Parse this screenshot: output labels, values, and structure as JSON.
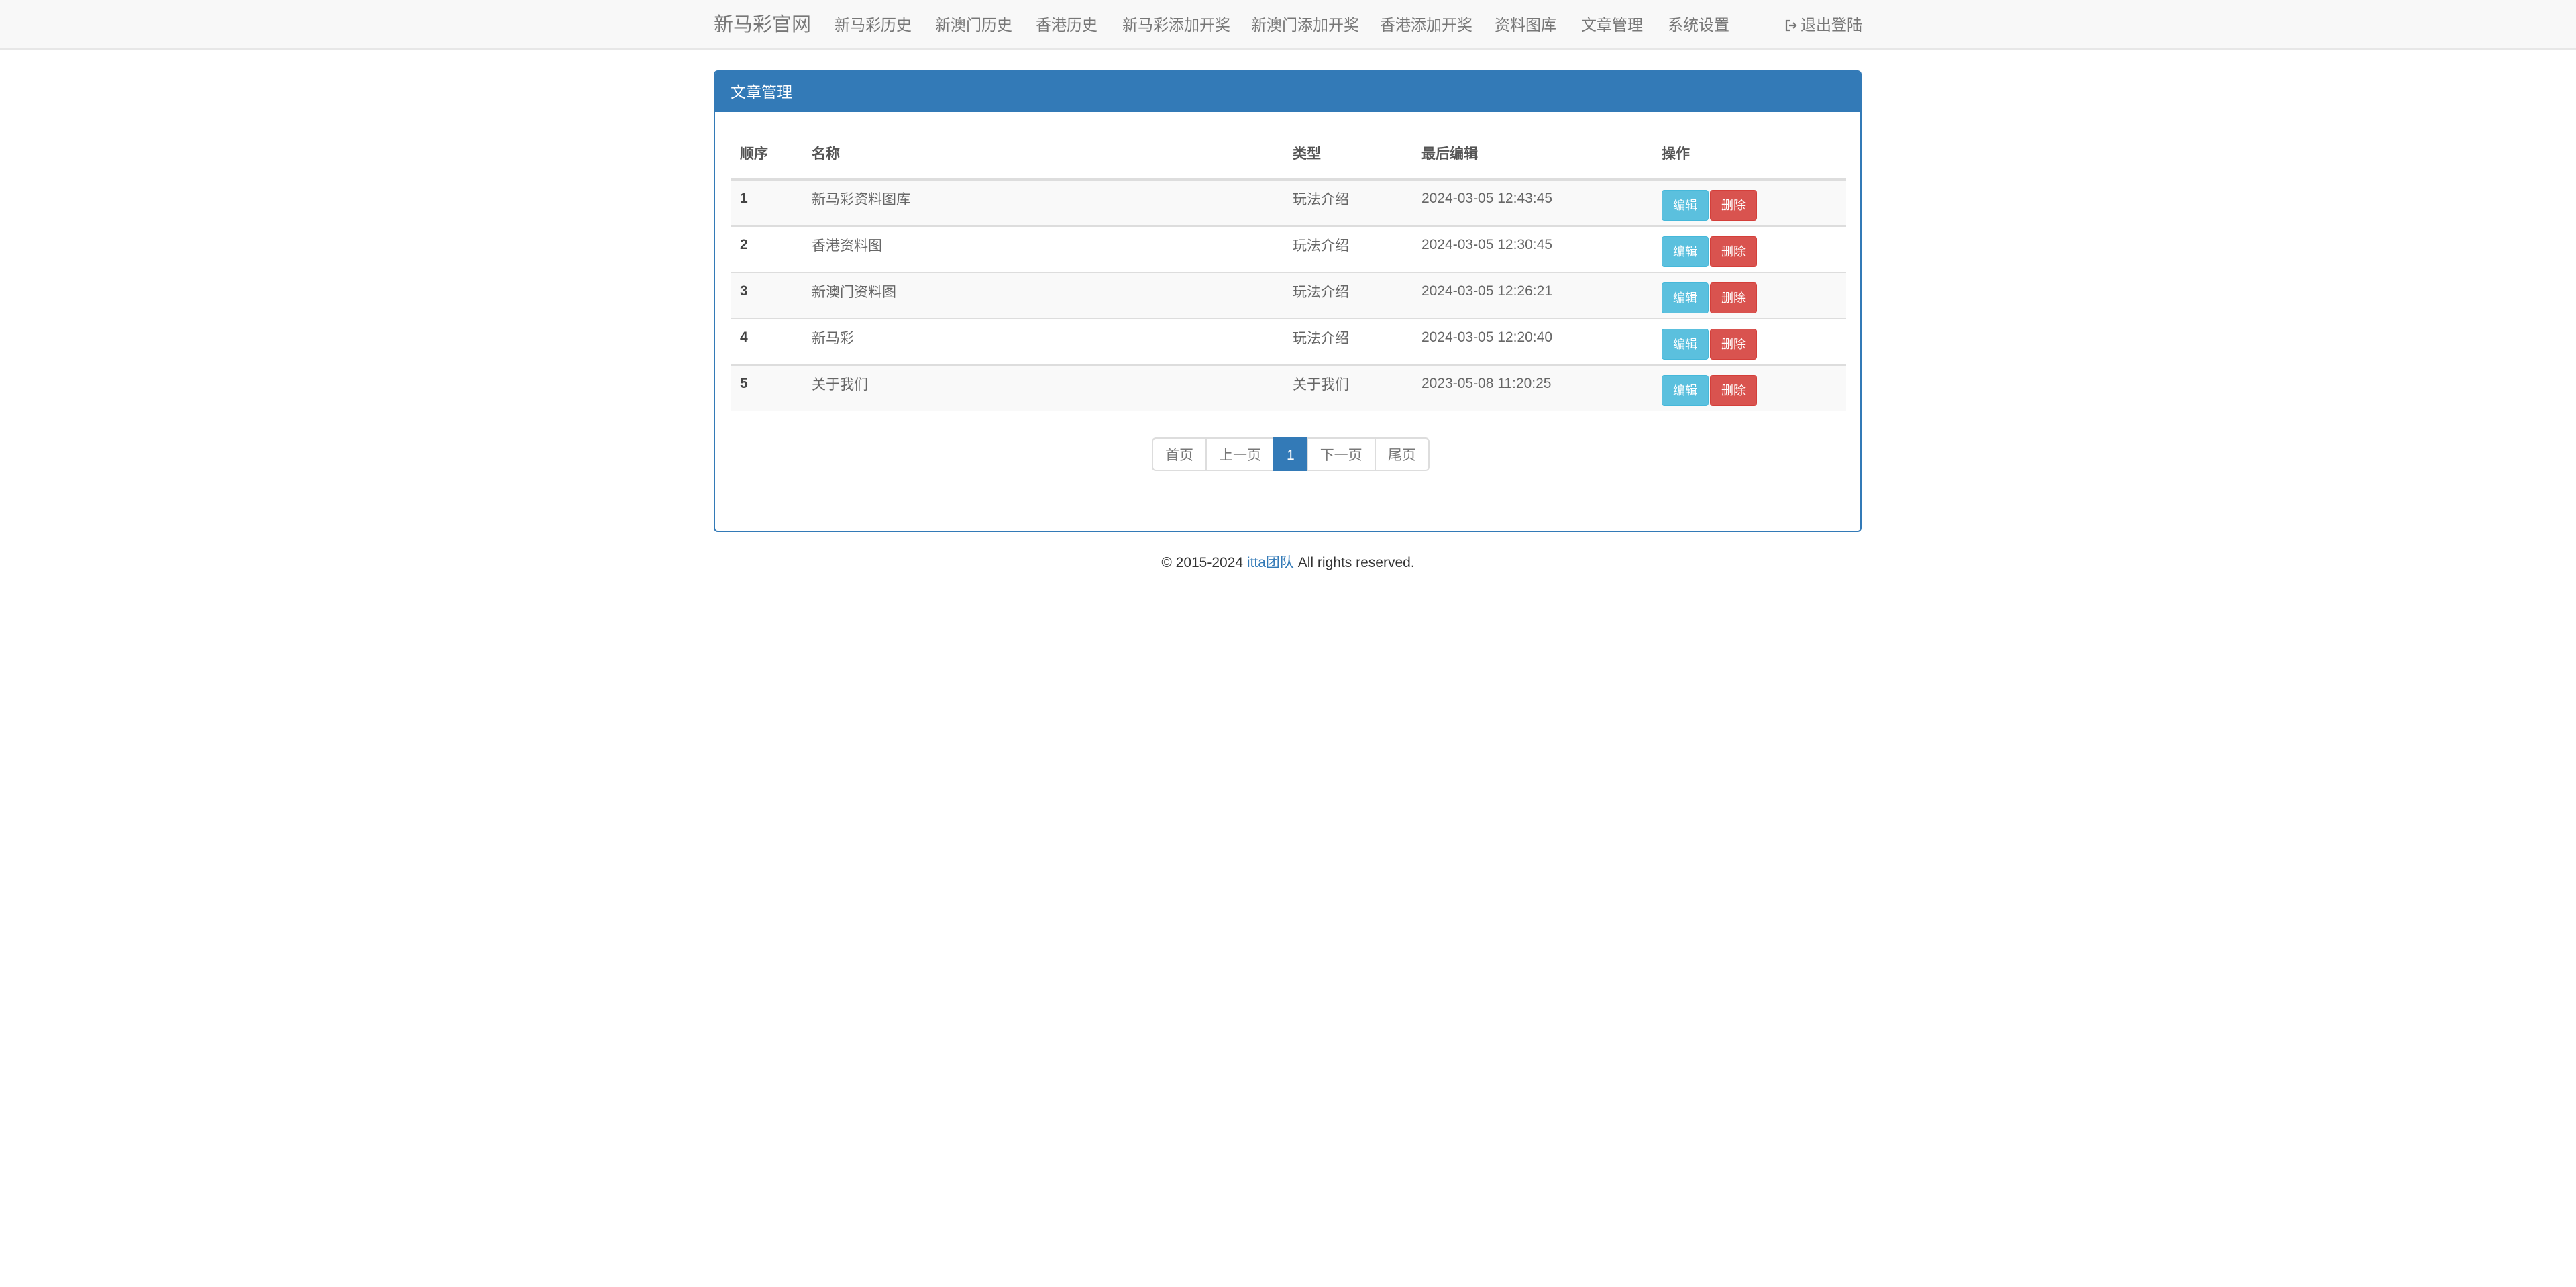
{
  "navbar": {
    "brand": "新马彩官网",
    "links": [
      "新马彩历史",
      "新澳门历史",
      "香港历史",
      "新马彩添加开奖",
      "新澳门添加开奖",
      "香港添加开奖",
      "资料图库",
      "文章管理",
      "系统设置"
    ],
    "logout": "退出登陆"
  },
  "panel": {
    "title": "文章管理",
    "columns": [
      "顺序",
      "名称",
      "类型",
      "最后编辑",
      "操作"
    ],
    "rows": [
      {
        "order": "1",
        "name": "新马彩资料图库",
        "type": "玩法介绍",
        "edited": "2024-03-05 12:43:45"
      },
      {
        "order": "2",
        "name": "香港资料图",
        "type": "玩法介绍",
        "edited": "2024-03-05 12:30:45"
      },
      {
        "order": "3",
        "name": "新澳门资料图",
        "type": "玩法介绍",
        "edited": "2024-03-05 12:26:21"
      },
      {
        "order": "4",
        "name": "新马彩",
        "type": "玩法介绍",
        "edited": "2024-03-05 12:20:40"
      },
      {
        "order": "5",
        "name": "关于我们",
        "type": "关于我们",
        "edited": "2023-05-08 11:20:25"
      }
    ],
    "edit_label": "编辑",
    "delete_label": "删除"
  },
  "pagination": {
    "first": "首页",
    "prev": "上一页",
    "current": "1",
    "next": "下一页",
    "last": "尾页"
  },
  "footer": {
    "prefix": "© 2015-2024 ",
    "team": "itta团队",
    "suffix": " All rights reserved."
  },
  "colors": {
    "primary": "#337ab7",
    "info": "#5bc0de",
    "danger": "#d9534f",
    "navbar_bg": "#f8f8f8"
  }
}
